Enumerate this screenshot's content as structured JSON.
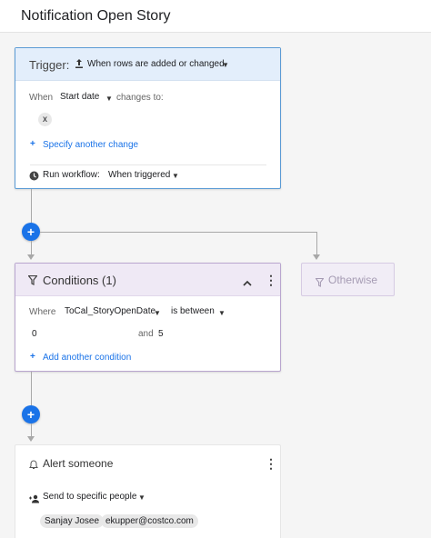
{
  "app": {
    "title": "Notification Open Story"
  },
  "trigger": {
    "label": "Trigger:",
    "icon": "upload-icon",
    "event": "When rows are added or changed",
    "when_label": "When",
    "field": "Start date",
    "changes_to_label": "changes to:",
    "value_chip": "x",
    "specify_link": "Specify another change",
    "run_label": "Run workflow:",
    "run_value": "When triggered"
  },
  "conditions": {
    "title": "Conditions (1)",
    "where_label": "Where",
    "field": "ToCal_StoryOpenDate",
    "operator": "is between",
    "value_from": "0",
    "and_label": "and",
    "value_to": "5",
    "add_link": "Add another condition"
  },
  "otherwise": {
    "label": "Otherwise"
  },
  "alert": {
    "title": "Alert someone",
    "send_label": "Send to specific people",
    "recipients": [
      "Sanjay Josee",
      "ekupper@costco.com"
    ]
  },
  "colors": {
    "accent": "#1a73e8",
    "trigger_header": "#e3eefb",
    "condition_header": "#efe9f5"
  }
}
